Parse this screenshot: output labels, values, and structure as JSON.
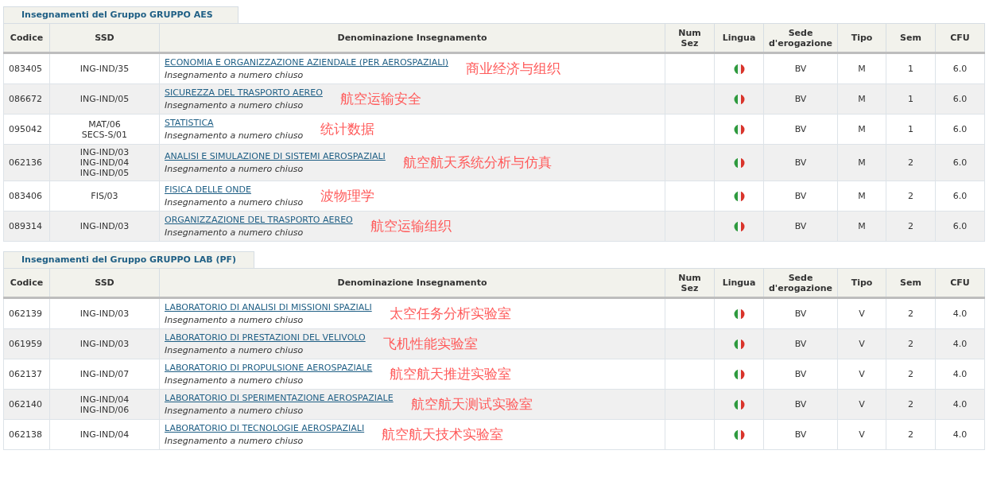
{
  "groups": [
    {
      "title": "Insegnamenti del Gruppo GRUPPO AES",
      "columns": [
        "Codice",
        "SSD",
        "Denominazione Insegnamento",
        "Num Sez",
        "Lingua",
        "Sede d'erogazione",
        "Tipo",
        "Sem",
        "CFU"
      ],
      "rows": [
        {
          "code": "083405",
          "ssd": [
            "ING-IND/35"
          ],
          "name": "ECONOMIA E ORGANIZZAZIONE AZIENDALE (PER AEROSPAZIALI)",
          "note": "Insegnamento a numero chiuso",
          "annotation": "商业经济与组织",
          "site": "BV",
          "type": "M",
          "sem": "1",
          "cfu": "6.0"
        },
        {
          "code": "086672",
          "ssd": [
            "ING-IND/05"
          ],
          "name": "SICUREZZA DEL TRASPORTO AEREO",
          "note": "Insegnamento a numero chiuso",
          "annotation": "航空运输安全",
          "site": "BV",
          "type": "M",
          "sem": "1",
          "cfu": "6.0"
        },
        {
          "code": "095042",
          "ssd": [
            "MAT/06",
            "SECS-S/01"
          ],
          "name": "STATISTICA",
          "note": "Insegnamento a numero chiuso",
          "annotation": "统计数据",
          "site": "BV",
          "type": "M",
          "sem": "1",
          "cfu": "6.0"
        },
        {
          "code": "062136",
          "ssd": [
            "ING-IND/03",
            "ING-IND/04",
            "ING-IND/05"
          ],
          "name": "ANALISI E SIMULAZIONE DI SISTEMI AEROSPAZIALI",
          "note": "Insegnamento a numero chiuso",
          "annotation": "航空航天系统分析与仿真",
          "site": "BV",
          "type": "M",
          "sem": "2",
          "cfu": "6.0"
        },
        {
          "code": "083406",
          "ssd": [
            "FIS/03"
          ],
          "name": "FISICA DELLE ONDE",
          "note": "Insegnamento a numero chiuso",
          "annotation": "波物理学",
          "site": "BV",
          "type": "M",
          "sem": "2",
          "cfu": "6.0"
        },
        {
          "code": "089314",
          "ssd": [
            "ING-IND/03"
          ],
          "name": "ORGANIZZAZIONE DEL TRASPORTO AEREO",
          "note": "Insegnamento a numero chiuso",
          "annotation": "航空运输组织",
          "site": "BV",
          "type": "M",
          "sem": "2",
          "cfu": "6.0"
        }
      ]
    },
    {
      "title": "Insegnamenti del Gruppo GRUPPO LAB (PF)",
      "columns": [
        "Codice",
        "SSD",
        "Denominazione Insegnamento",
        "Num Sez",
        "Lingua",
        "Sede d'erogazione",
        "Tipo",
        "Sem",
        "CFU"
      ],
      "rows": [
        {
          "code": "062139",
          "ssd": [
            "ING-IND/03"
          ],
          "name": "LABORATORIO DI ANALISI DI MISSIONI SPAZIALI",
          "note": "Insegnamento a numero chiuso",
          "annotation": "太空任务分析实验室",
          "site": "BV",
          "type": "V",
          "sem": "2",
          "cfu": "4.0"
        },
        {
          "code": "061959",
          "ssd": [
            "ING-IND/03"
          ],
          "name": "LABORATORIO DI PRESTAZIONI DEL VELIVOLO",
          "note": "Insegnamento a numero chiuso",
          "annotation": "飞机性能实验室",
          "site": "BV",
          "type": "V",
          "sem": "2",
          "cfu": "4.0"
        },
        {
          "code": "062137",
          "ssd": [
            "ING-IND/07"
          ],
          "name": "LABORATORIO DI PROPULSIONE AEROSPAZIALE",
          "note": "Insegnamento a numero chiuso",
          "annotation": "航空航天推进实验室",
          "site": "BV",
          "type": "V",
          "sem": "2",
          "cfu": "4.0"
        },
        {
          "code": "062140",
          "ssd": [
            "ING-IND/04",
            "ING-IND/06"
          ],
          "name": "LABORATORIO DI SPERIMENTAZIONE AEROSPAZIALE",
          "note": "Insegnamento a numero chiuso",
          "annotation": "航空航天测试实验室",
          "site": "BV",
          "type": "V",
          "sem": "2",
          "cfu": "4.0"
        },
        {
          "code": "062138",
          "ssd": [
            "ING-IND/04"
          ],
          "name": "LABORATORIO DI TECNOLOGIE AEROSPAZIALI",
          "note": "Insegnamento a numero chiuso",
          "annotation": "航空航天技术实验室",
          "site": "BV",
          "type": "V",
          "sem": "2",
          "cfu": "4.0"
        }
      ]
    }
  ]
}
